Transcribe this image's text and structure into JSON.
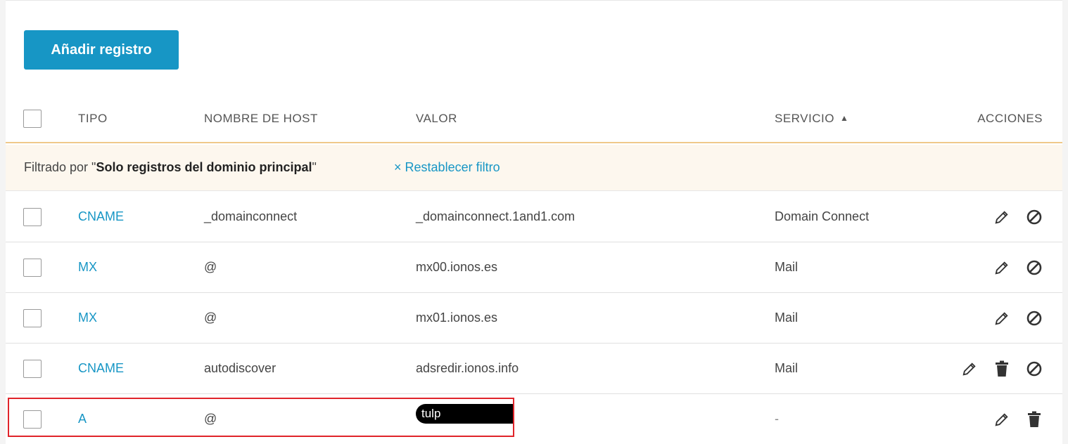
{
  "toolbar": {
    "add_label": "Añadir registro"
  },
  "table": {
    "headers": {
      "tipo": "TIPO",
      "host": "NOMBRE DE HOST",
      "valor": "VALOR",
      "servicio": "SERVICIO",
      "servicio_sort": "▲",
      "acciones": "ACCIONES"
    },
    "filter": {
      "prefix": "Filtrado por \"",
      "value": "Solo registros del dominio principal",
      "suffix": "\"",
      "reset_icon": "×",
      "reset_label": "Restablecer filtro"
    },
    "rows": [
      {
        "tipo": "CNAME",
        "host": "_domainconnect",
        "valor": "_domainconnect.1and1.com",
        "servicio": "Domain Connect"
      },
      {
        "tipo": "MX",
        "host": "@",
        "valor": "mx00.ionos.es",
        "servicio": "Mail"
      },
      {
        "tipo": "MX",
        "host": "@",
        "valor": "mx01.ionos.es",
        "servicio": "Mail"
      },
      {
        "tipo": "CNAME",
        "host": "autodiscover",
        "valor": "adsredir.ionos.info",
        "servicio": "Mail"
      },
      {
        "tipo": "A",
        "host": "@",
        "valor": "tulp",
        "servicio": "-"
      }
    ]
  },
  "colors": {
    "accent": "#1796c5",
    "filter_bg": "#fdf7ee",
    "highlight": "#e0242a"
  }
}
